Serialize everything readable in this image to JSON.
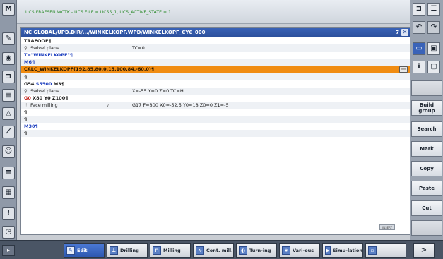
{
  "status": {
    "text": "UCS FRAESEN WCTK - UCS FILE = UCSS_1, UCS_ACTIVE_STATE = 1"
  },
  "editor": {
    "title": "NC GLOBAL/UPD.DIR/.../WINKELKOPF.WPD/WINKELKOPF_CYC_000",
    "number": "7",
    "tag": "INSERT",
    "lines": [
      {
        "text": "TRAFOOF¶"
      },
      {
        "icon": "swivel-icon",
        "text": "Swivel plane",
        "col2": "TC=0"
      },
      {
        "text": "T=\"WINKELKOPF\"¶",
        "color": "blue"
      },
      {
        "text": "M6¶",
        "color": "blue"
      },
      {
        "text": "CALC_WINKELKOPF(192.85,80.0,15,100.84,-60,0)¶",
        "selected": true
      },
      {
        "text": "¶"
      },
      {
        "text": "G54 S5500 M3¶",
        "parts": [
          "G54",
          "S5500",
          "M3¶"
        ]
      },
      {
        "icon": "swivel-icon",
        "text": "Swivel plane",
        "col2": "X=-55 Y=0 Z=0 TC=H"
      },
      {
        "text": "G0 X80 Y0 Z100¶",
        "parts": [
          "G0",
          "X80 Y0 Z100¶"
        ]
      },
      {
        "icon": "face-milling-icon",
        "text": "Face milling",
        "chev": "∨",
        "col2": "G17 F=800 X0=-52.5 Y0=18 Z0=0 Z1=-5"
      },
      {
        "text": "¶"
      },
      {
        "text": "¶"
      },
      {
        "text": "M30¶",
        "color": "blue"
      },
      {
        "text": "¶"
      }
    ]
  },
  "right_bar": {
    "soft_keys": [
      "",
      "Build group",
      "Search",
      "Mark",
      "Copy",
      "Paste",
      "Cut",
      ""
    ]
  },
  "bottom_bar": {
    "buttons": [
      {
        "label": "Edit",
        "icon": "edit-icon",
        "active": true
      },
      {
        "label": "Drilling",
        "icon": "drill-icon"
      },
      {
        "label": "Milling",
        "icon": "mill-icon"
      },
      {
        "label": "Cont. mill.",
        "icon": "contour-icon"
      },
      {
        "label": "Turn-ing",
        "icon": "turn-icon"
      },
      {
        "label": "Vari-ous",
        "icon": "various-icon"
      },
      {
        "label": "Simu-lation",
        "icon": "simulation-icon"
      },
      {
        "label": "",
        "icon": "extra-icon",
        "dim": true
      }
    ],
    "next": ">"
  },
  "colors": {
    "selection": "#f08c12",
    "title_bar": "#2b4f9a",
    "keyword_blue": "#1d3fbf",
    "keyword_red": "#c2221a"
  }
}
